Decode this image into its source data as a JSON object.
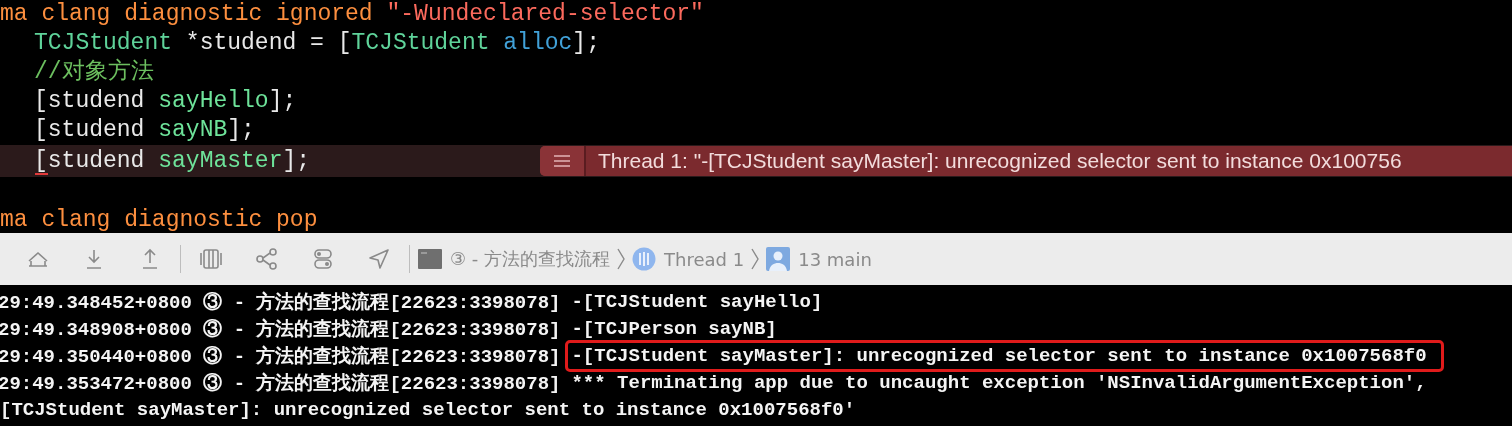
{
  "editor": {
    "lines": [
      {
        "kind": "directive",
        "segments": [
          {
            "text": "ma clang diagnostic ignored ",
            "kind": "preprocessor"
          },
          {
            "text": "\"-Wundeclared-selector\"",
            "kind": "string"
          }
        ],
        "error": false
      },
      {
        "kind": "code",
        "segments": [
          {
            "text": "TCJStudent",
            "kind": "class"
          },
          {
            "text": " *studend = [",
            "kind": "plain"
          },
          {
            "text": "TCJStudent",
            "kind": "class"
          },
          {
            "text": " alloc",
            "kind": "system"
          },
          {
            "text": "];",
            "kind": "plain"
          }
        ],
        "error": false
      },
      {
        "kind": "code",
        "segments": [
          {
            "text": "//对象方法",
            "kind": "comment"
          }
        ],
        "error": false
      },
      {
        "kind": "code",
        "segments": [
          {
            "text": "[studend ",
            "kind": "plain"
          },
          {
            "text": "sayHello",
            "kind": "method"
          },
          {
            "text": "];",
            "kind": "plain"
          }
        ],
        "error": false
      },
      {
        "kind": "code",
        "segments": [
          {
            "text": "[studend ",
            "kind": "plain"
          },
          {
            "text": "sayNB",
            "kind": "method"
          },
          {
            "text": "];",
            "kind": "plain"
          }
        ],
        "error": false
      },
      {
        "kind": "code",
        "segments": [
          {
            "text": "[studend ",
            "kind": "plain"
          },
          {
            "text": "sayMaster",
            "kind": "method"
          },
          {
            "text": "];",
            "kind": "plain"
          }
        ],
        "error": true
      },
      {
        "kind": "blank",
        "error": false
      },
      {
        "kind": "directive",
        "segments": [
          {
            "text": "ma clang diagnostic pop",
            "kind": "preprocessor"
          }
        ],
        "error": false
      }
    ],
    "error_banner": {
      "text": "Thread 1: \"-[TCJStudent sayMaster]: unrecognized selector sent to instance 0x100756"
    }
  },
  "debug_bar": {
    "breadcrumbs": [
      {
        "text": "③ - 方法的查找流程",
        "kind": "process"
      },
      {
        "text": "Thread 1",
        "kind": "thread"
      },
      {
        "text": "13 main",
        "kind": "frame"
      }
    ]
  },
  "console": {
    "lines": [
      {
        "prefix": "29:49.348452+0800 ③ - 方法的查找流程[22623:3398078]",
        "message": "-[TCJStudent sayHello]",
        "boxed": false
      },
      {
        "prefix": "29:49.348908+0800 ③ - 方法的查找流程[22623:3398078]",
        "message": "-[TCJPerson sayNB]",
        "boxed": false
      },
      {
        "prefix": "29:49.350440+0800 ③ - 方法的查找流程[22623:3398078]",
        "message": "-[TCJStudent sayMaster]: unrecognized selector sent to instance 0x1007568f0",
        "boxed": true
      },
      {
        "prefix": "29:49.353472+0800 ③ - 方法的查找流程[22623:3398078]",
        "message": "*** Terminating app due to uncaught exception 'NSInvalidArgumentException',",
        "boxed": false
      },
      {
        "message": "[TCJStudent sayMaster]: unrecognized selector sent to instance 0x1007568f0'",
        "boxed": false
      }
    ]
  }
}
